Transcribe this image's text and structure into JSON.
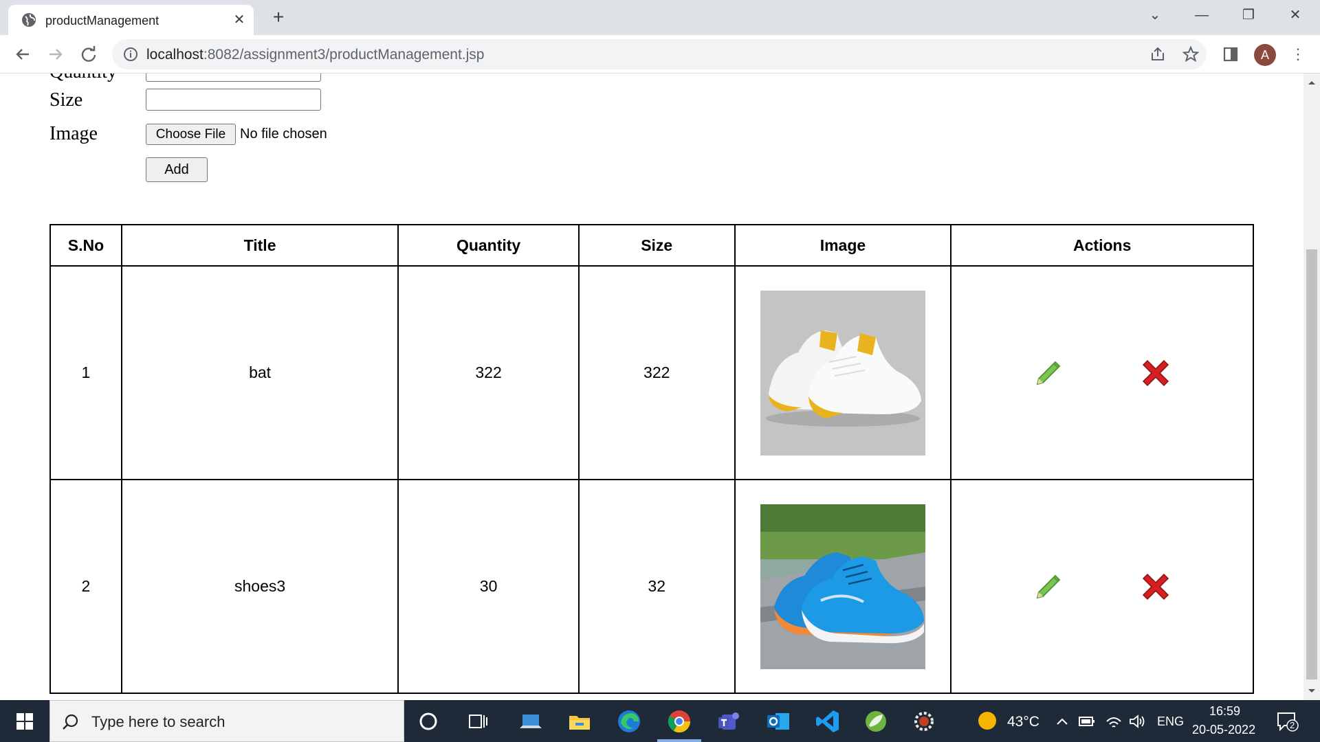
{
  "browser": {
    "tab_title": "productManagement",
    "tab_close": "✕",
    "new_tab": "+",
    "url_host": "localhost",
    "url_path": ":8082/assignment3/productManagement.jsp",
    "avatar_letter": "A",
    "window_controls": {
      "dropdown": "⌄",
      "minimize": "—",
      "restore": "❐",
      "close": "✕"
    }
  },
  "form": {
    "fields": [
      {
        "label": "Quantity",
        "value": ""
      },
      {
        "label": "Size",
        "value": ""
      }
    ],
    "image_label": "Image",
    "file_button": "Choose File",
    "file_status": "No file chosen",
    "add_button": "Add"
  },
  "table": {
    "headers": [
      "S.No",
      "Title",
      "Quantity",
      "Size",
      "Image",
      "Actions"
    ],
    "rows": [
      {
        "sno": "1",
        "title": "bat",
        "quantity": "322",
        "size": "322",
        "image": "white-yellow-sneakers",
        "edit_icon": "pencil-icon",
        "delete_icon": "red-x-icon"
      },
      {
        "sno": "2",
        "title": "shoes3",
        "quantity": "30",
        "size": "32",
        "image": "blue-sneakers",
        "edit_icon": "pencil-icon",
        "delete_icon": "red-x-icon"
      }
    ]
  },
  "taskbar": {
    "search_placeholder": "Type here to search",
    "temperature": "43°C",
    "language": "ENG",
    "time": "16:59",
    "date": "20-05-2022",
    "notification_count": "2",
    "pinned": [
      "cortana-icon",
      "task-view-icon",
      "laptop-icon",
      "file-explorer-icon",
      "edge-icon",
      "chrome-icon",
      "teams-icon",
      "outlook-icon",
      "vscode-icon",
      "spring-icon",
      "settings-gear-icon"
    ]
  },
  "colors": {
    "taskbar_bg": "#1f2a38",
    "tabstrip_bg": "#dee1e6",
    "delete_red": "#d42020",
    "edit_green": "#6dbe45"
  }
}
